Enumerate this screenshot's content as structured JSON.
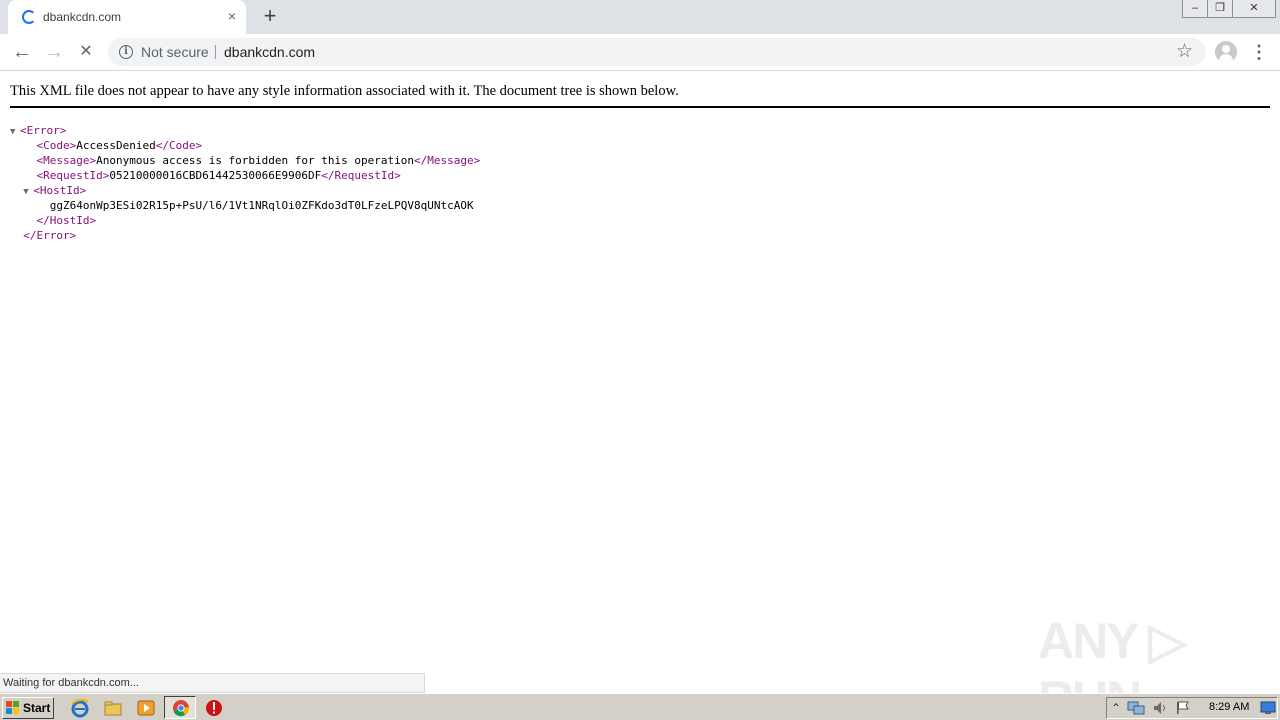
{
  "tab": {
    "title": "dbankcdn.com",
    "close": "×"
  },
  "toolbar": {
    "new_tab": "+",
    "back": "←",
    "forward": "→",
    "stop": "✕",
    "security_label": "Not secure",
    "url": "dbankcdn.com",
    "star": "☆",
    "menu": "⋮"
  },
  "window_controls": {
    "minimize": "–",
    "maximize": "❐",
    "close": "✕"
  },
  "content": {
    "notice": "This XML file does not appear to have any style information associated with it. The document tree is shown below.",
    "xml": {
      "error_open": "<Error>",
      "code_open": "<Code>",
      "code_value": "AccessDenied",
      "code_close": "</Code>",
      "message_open": "<Message>",
      "message_value": "Anonymous access is forbidden for this operation",
      "message_close": "</Message>",
      "requestid_open": "<RequestId>",
      "requestid_value": "05210000016CBD61442530066E9906DF",
      "requestid_close": "</RequestId>",
      "hostid_open": "<HostId>",
      "hostid_value": "ggZ64onWp3ESi02R15p+PsU/l6/1Vt1NRqlOi0ZFKdo3dT0LFzeLPQV8qUNtcAOK",
      "hostid_close": "</HostId>",
      "error_close": "</Error>",
      "toggle": "▼"
    }
  },
  "watermark": "ANY ▷ RUN",
  "status": "Waiting for dbankcdn.com...",
  "taskbar": {
    "start_label": "Start",
    "clock": "8:29 AM",
    "tray_arrow": "⌃"
  },
  "colors": {
    "xml_tag": "#881280",
    "spinner": "#1a73e8",
    "tabstrip": "#dee1e6",
    "taskbar": "#d4d0c8"
  }
}
